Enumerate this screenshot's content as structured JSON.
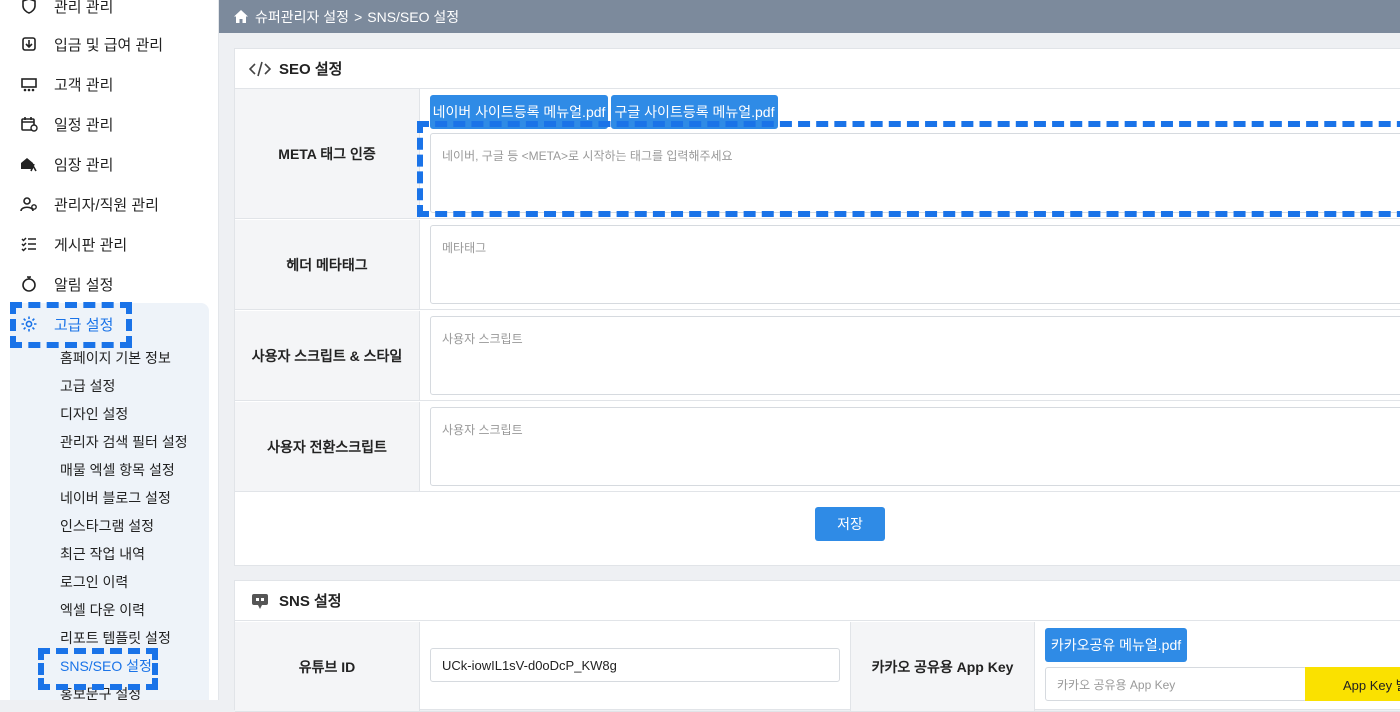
{
  "sidebar": {
    "items": [
      {
        "label": "관리 관리",
        "icon": "shield-icon"
      },
      {
        "label": "입금 및 급여 관리",
        "icon": "wallet-icon"
      },
      {
        "label": "고객 관리",
        "icon": "users-icon"
      },
      {
        "label": "일정 관리",
        "icon": "calendar-icon"
      },
      {
        "label": "임장 관리",
        "icon": "home-walk-icon"
      },
      {
        "label": "관리자/직원 관리",
        "icon": "user-gear-icon"
      },
      {
        "label": "게시판 관리",
        "icon": "list-icon"
      },
      {
        "label": "알림 설정",
        "icon": "bell-icon"
      },
      {
        "label": "고급 설정",
        "icon": "gear-icon"
      }
    ],
    "sub_items": [
      "홈페이지 기본 정보",
      "고급 설정",
      "디자인 설정",
      "관리자 검색 필터 설정",
      "매물 엑셀 항목 설정",
      "네이버 블로그 설정",
      "인스타그램 설정",
      "최근 작업 내역",
      "로그인 이력",
      "엑셀 다운 이력",
      "리포트 템플릿 설정",
      "SNS/SEO 설정",
      "홍보문구 설정"
    ]
  },
  "breadcrumb": {
    "parent": "슈퍼관리자 설정",
    "separator": ">",
    "current": "SNS/SEO 설정"
  },
  "seo": {
    "title": "SEO 설정",
    "naver_pdf": "네이버 사이트등록 메뉴얼.pdf",
    "google_pdf": "구글 사이트등록 메뉴얼.pdf",
    "meta_label": "META 태그 인증",
    "meta_placeholder": "네이버, 구글 등 <META>로 시작하는 태그를 입력해주세요",
    "header_label": "헤더 메타태그",
    "header_placeholder": "메타태그",
    "script_label": "사용자 스크립트 & 스타일",
    "script_placeholder": "사용자 스크립트",
    "conv_label": "사용자 전환스크립트",
    "conv_placeholder": "사용자 스크립트",
    "save": "저장"
  },
  "sns": {
    "title": "SNS 설정",
    "youtube_label": "유튜브 ID",
    "youtube_value": "UCk-iowIL1sV-d0oDcP_KW8g",
    "kakao_label": "카카오 공유용 App Key",
    "kakao_pdf": "카카오공유 메뉴얼.pdf",
    "kakao_placeholder": "카카오 공유용 App Key",
    "kakao_button": "App Key 발"
  },
  "colors": {
    "accent": "#2f8be6",
    "highlight": "#1a73e8",
    "topbar": "#7c8a9c",
    "kakao": "#fae100"
  }
}
